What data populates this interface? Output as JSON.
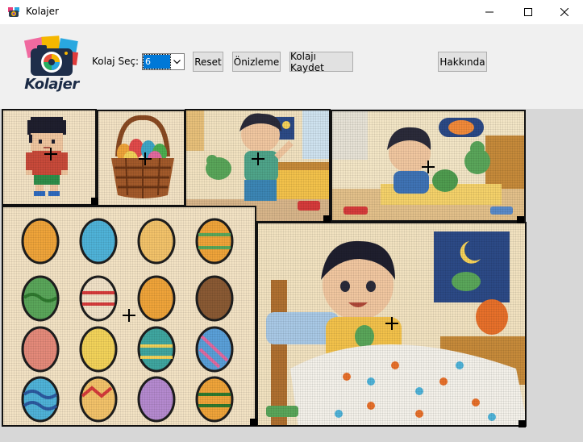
{
  "window": {
    "title": "Kolajer",
    "controls": [
      "minimize-icon",
      "maximize-icon",
      "close-icon"
    ]
  },
  "toolbar": {
    "logo_text": "Kolajer",
    "layout_label": "Kolaj Seç:",
    "layout_select": {
      "value": "6",
      "options_visible": [
        "6"
      ]
    },
    "reset_label": "Reset",
    "preview_label": "Önizleme",
    "save_label": "Kolajı Kaydet",
    "about_label": "Hakkında"
  },
  "collage": {
    "tile_count": 6,
    "tiles": [
      {
        "name": "pixel-boy",
        "subject": "pixel art boy"
      },
      {
        "name": "easter-basket",
        "subject": "pixel art basket of easter eggs"
      },
      {
        "name": "boy-with-dino-bedroom",
        "subject": "boy on bed with dinosaur toy"
      },
      {
        "name": "boy-playing-floor",
        "subject": "boy playing with dinosaur toys on floor"
      },
      {
        "name": "easter-eggs-grid",
        "subject": "pixel art easter egg grid"
      },
      {
        "name": "boy-in-bed",
        "subject": "boy waking up in bed"
      }
    ]
  },
  "colors": {
    "canvas_bg": "#d7d7d7",
    "cream": "#f3e3c4",
    "selection": "#0078d7",
    "logo_blue": "#1b2b46"
  }
}
